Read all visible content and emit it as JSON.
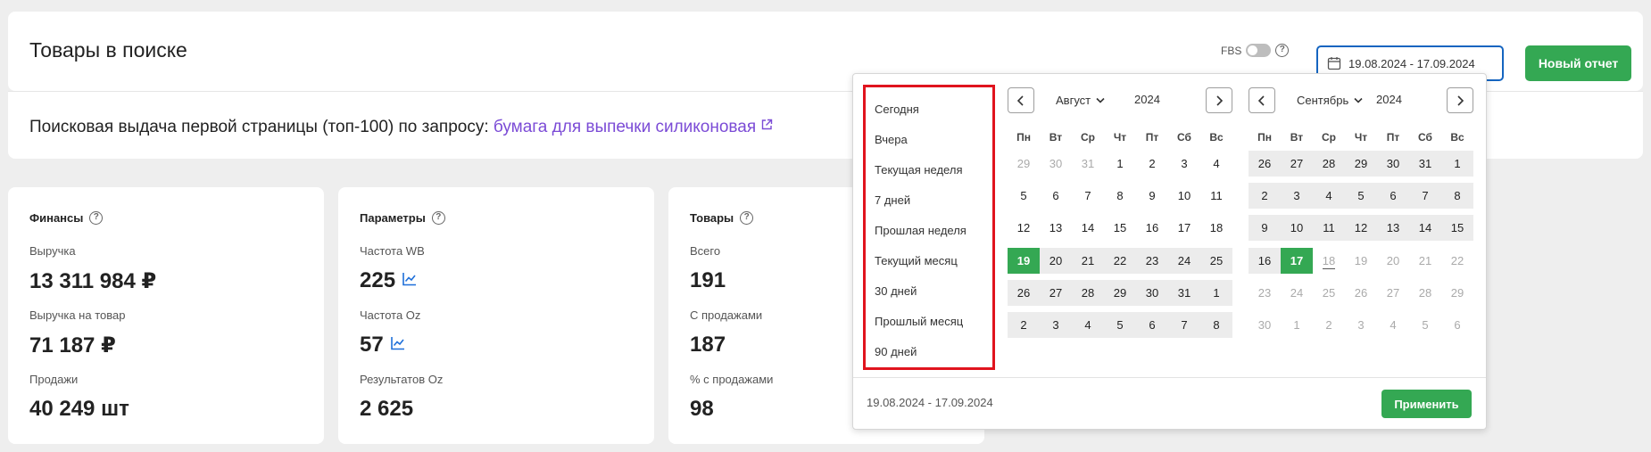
{
  "header": {
    "title": "Товары в поиске",
    "fbs_label": "FBS",
    "date_range_value": "19.08.2024 - 17.09.2024",
    "new_report_label": "Новый отчет"
  },
  "query": {
    "prefix": "Поисковая выдача первой страницы (топ-100) по запросу:",
    "link_text": "бумага для выпечки силиконовая"
  },
  "cards": [
    {
      "title": "Финансы",
      "rows": [
        {
          "label": "Выручка",
          "value": "13 311 984 ₽",
          "chart": false
        },
        {
          "label": "Выручка на товар",
          "value": "71 187 ₽",
          "chart": false
        },
        {
          "label": "Продажи",
          "value": "40 249 шт",
          "chart": false
        }
      ]
    },
    {
      "title": "Параметры",
      "rows": [
        {
          "label": "Частота WB",
          "value": "225",
          "chart": true
        },
        {
          "label": "Частота Oz",
          "value": "57",
          "chart": true
        },
        {
          "label": "Результатов Oz",
          "value": "2 625",
          "chart": false
        }
      ]
    },
    {
      "title": "Товары",
      "rows": [
        {
          "label": "Всего",
          "value": "191",
          "chart": false
        },
        {
          "label": "С продажами",
          "value": "187",
          "chart": false
        },
        {
          "label": "% с продажами",
          "value": "98",
          "chart": false
        }
      ]
    }
  ],
  "datepicker": {
    "presets": [
      "Сегодня",
      "Вчера",
      "Текущая неделя",
      "7 дней",
      "Прошлая неделя",
      "Текущий месяц",
      "30 дней",
      "Прошлый месяц",
      "90 дней"
    ],
    "weekdays": [
      "Пн",
      "Вт",
      "Ср",
      "Чт",
      "Пт",
      "Сб",
      "Вс"
    ],
    "left": {
      "month": "Август",
      "year": "2024",
      "days": [
        [
          "29",
          "30",
          "31",
          "1",
          "2",
          "3",
          "4"
        ],
        [
          "5",
          "6",
          "7",
          "8",
          "9",
          "10",
          "11"
        ],
        [
          "12",
          "13",
          "14",
          "15",
          "16",
          "17",
          "18"
        ],
        [
          "19",
          "20",
          "21",
          "22",
          "23",
          "24",
          "25"
        ],
        [
          "26",
          "27",
          "28",
          "29",
          "30",
          "31",
          "1"
        ],
        [
          "2",
          "3",
          "4",
          "5",
          "6",
          "7",
          "8"
        ]
      ],
      "states": [
        [
          "m",
          "m",
          "m",
          "n",
          "n",
          "n",
          "n"
        ],
        [
          "n",
          "n",
          "n",
          "n",
          "n",
          "n",
          "n"
        ],
        [
          "n",
          "n",
          "n",
          "n",
          "n",
          "n",
          "n"
        ],
        [
          "s",
          "r",
          "r",
          "r",
          "r",
          "r",
          "r"
        ],
        [
          "r",
          "r",
          "r",
          "r",
          "r",
          "r",
          "r"
        ],
        [
          "r",
          "r",
          "r",
          "r",
          "r",
          "r",
          "r"
        ]
      ]
    },
    "right": {
      "month": "Сентябрь",
      "year": "2024",
      "days": [
        [
          "26",
          "27",
          "28",
          "29",
          "30",
          "31",
          "1"
        ],
        [
          "2",
          "3",
          "4",
          "5",
          "6",
          "7",
          "8"
        ],
        [
          "9",
          "10",
          "11",
          "12",
          "13",
          "14",
          "15"
        ],
        [
          "16",
          "17",
          "18",
          "19",
          "20",
          "21",
          "22"
        ],
        [
          "23",
          "24",
          "25",
          "26",
          "27",
          "28",
          "29"
        ],
        [
          "30",
          "1",
          "2",
          "3",
          "4",
          "5",
          "6"
        ]
      ],
      "states": [
        [
          "r",
          "r",
          "r",
          "r",
          "r",
          "r",
          "r"
        ],
        [
          "r",
          "r",
          "r",
          "r",
          "r",
          "r",
          "r"
        ],
        [
          "r",
          "r",
          "r",
          "r",
          "r",
          "r",
          "r"
        ],
        [
          "r",
          "s",
          "t",
          "m",
          "m",
          "m",
          "m"
        ],
        [
          "m",
          "m",
          "m",
          "m",
          "m",
          "m",
          "m"
        ],
        [
          "m",
          "m",
          "m",
          "m",
          "m",
          "m",
          "m"
        ]
      ]
    },
    "footer_range": "19.08.2024 - 17.09.2024",
    "apply_label": "Применить"
  }
}
